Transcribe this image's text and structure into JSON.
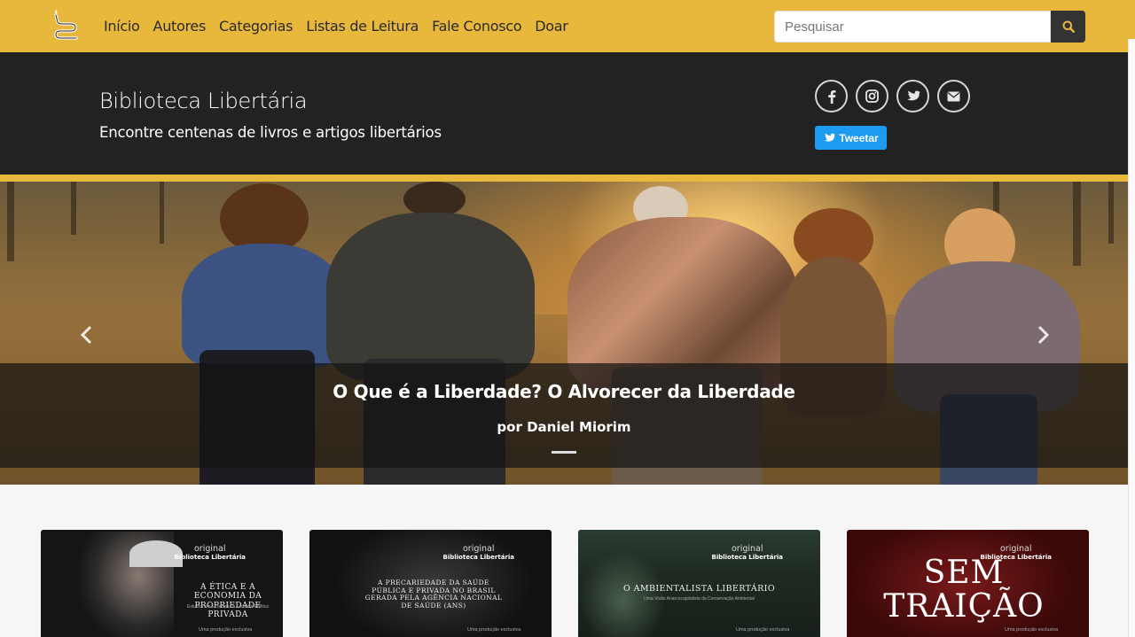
{
  "nav": {
    "links": [
      "Início",
      "Autores",
      "Categorias",
      "Listas de Leitura",
      "Fale Conosco",
      "Doar"
    ],
    "search_placeholder": "Pesquisar"
  },
  "header": {
    "title": "Biblioteca Libertária",
    "subtitle": "Encontre centenas de livros e artigos libertários",
    "social_icons": [
      "facebook-icon",
      "instagram-icon",
      "twitter-icon",
      "envelope-icon"
    ],
    "tweet_label": "Tweetar"
  },
  "hero": {
    "title": "O Que é a Liberdade? O Alvorecer da Liberdade",
    "author": "por Daniel Miorim"
  },
  "cards": [
    {
      "original": "original",
      "brand": "Biblioteca Libertária",
      "title": "A ÉTICA E A ECONOMIA DA PROPRIEDADE PRIVADA",
      "subtitle": "Estudos em Economia e Filosofia Política",
      "production": "Uma produção exclusiva"
    },
    {
      "original": "original",
      "brand": "Biblioteca Libertária",
      "title": "A PRECARIEDADE DA SAÚDE PÚBLICA E PRIVADA NO BRASIL GERADA PELA AGÊNCIA NACIONAL DE SAÚDE (ANS)",
      "subtitle": "",
      "production": "Uma produção exclusiva"
    },
    {
      "original": "original",
      "brand": "Biblioteca Libertária",
      "title": "O AMBIENTALISTA LIBERTÁRIO",
      "subtitle": "Uma Visão Anarcocapitalista da Conservação Ambiental",
      "production": "Uma produção exclusiva"
    },
    {
      "original": "original",
      "brand": "Biblioteca Libertária",
      "title": "SEM TRAIÇÃO",
      "subtitle": "",
      "production": "Uma produção exclusiva"
    }
  ],
  "colors": {
    "brand_gold": "#e8b83d",
    "header_dark": "#222222",
    "twitter_blue": "#1d9bf0"
  }
}
